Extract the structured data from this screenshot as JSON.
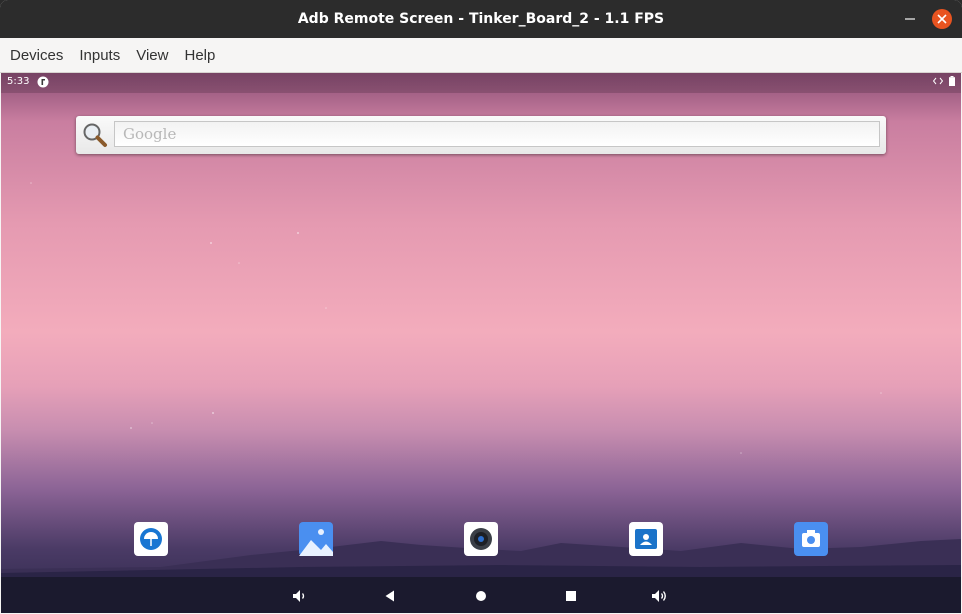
{
  "window": {
    "title": "Adb Remote Screen - Tinker_Board_2 - 1.1 FPS"
  },
  "menu": {
    "items": [
      "Devices",
      "Inputs",
      "View",
      "Help"
    ]
  },
  "statusbar": {
    "time": "5:33"
  },
  "search": {
    "placeholder": "Google"
  },
  "dock": {
    "apps": [
      "weather-app-icon",
      "gallery-app-icon",
      "music-app-icon",
      "contacts-app-icon",
      "camera-app-icon"
    ]
  },
  "navbar": {
    "buttons": [
      "volume-down-icon",
      "back-icon",
      "home-icon",
      "recents-icon",
      "volume-up-icon"
    ]
  },
  "colors": {
    "close_button": "#e95420",
    "titlebar": "#2c2c2c",
    "navbar": "#1b1a2e"
  }
}
